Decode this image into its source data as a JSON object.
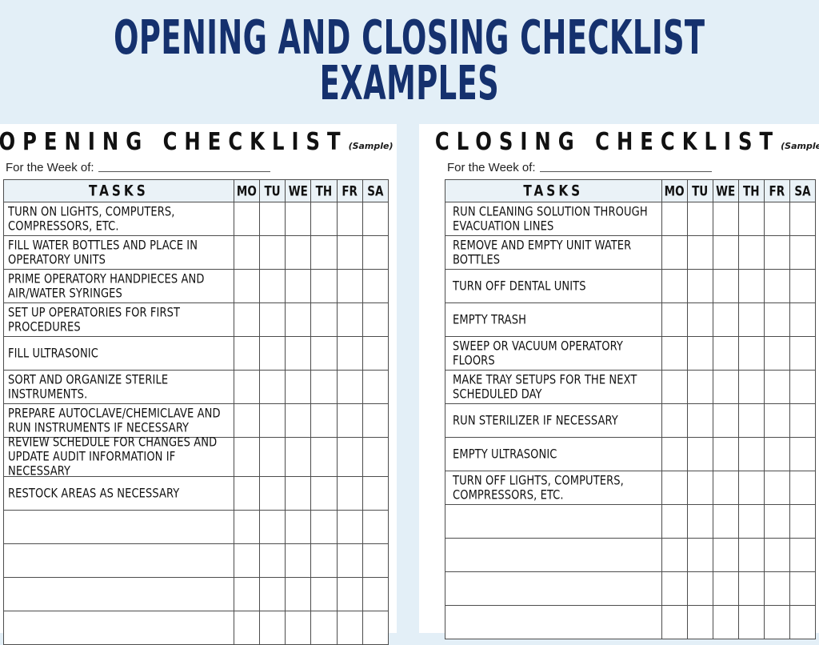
{
  "banner": {
    "line1": "OPENING AND CLOSING CHECKLIST",
    "line2": "EXAMPLES",
    "background_color": "#e3eff7",
    "text_color": "#15316e"
  },
  "colors": {
    "page_background": "#e3eff7",
    "panel_background": "#ffffff",
    "table_header_fill": "#eaf2f7",
    "table_border": "#4d4d4d",
    "title_navy": "#15316e",
    "text_black": "#111111"
  },
  "sheets": [
    {
      "id": "opening",
      "title": "OPENING CHECKLIST",
      "sample_tag": "(Sample)",
      "week_label": "For the Week of:",
      "week_value": "",
      "columns": {
        "tasks_header": "TASKS",
        "days": [
          "MO",
          "TU",
          "WE",
          "TH",
          "FR",
          "SA"
        ]
      },
      "tasks": [
        "TURN ON LIGHTS, COMPUTERS, COMPRESSORS, ETC.",
        "FILL WATER BOTTLES AND PLACE IN OPERATORY UNITS",
        "PRIME OPERATORY HANDPIECES AND AIR/WATER SYRINGES",
        "SET UP OPERATORIES FOR FIRST PROCEDURES",
        "FILL ULTRASONIC",
        "SORT AND ORGANIZE STERILE INSTRUMENTS.",
        "PREPARE AUTOCLAVE/CHEMICLAVE AND RUN INSTRUMENTS IF NECESSARY",
        "REVIEW SCHEDULE FOR CHANGES AND UPDATE AUDIT INFORMATION IF NECESSARY",
        "RESTOCK AREAS AS NECESSARY",
        "",
        "",
        "",
        ""
      ]
    },
    {
      "id": "closing",
      "title": "CLOSING CHECKLIST",
      "sample_tag": "(Sample)",
      "week_label": "For the Week of:",
      "week_value": "",
      "columns": {
        "tasks_header": "TASKS",
        "days": [
          "MO",
          "TU",
          "WE",
          "TH",
          "FR",
          "SA"
        ]
      },
      "tasks": [
        "RUN CLEANING SOLUTION THROUGH EVACUATION LINES",
        "REMOVE AND EMPTY UNIT WATER BOTTLES",
        "TURN OFF DENTAL UNITS",
        "EMPTY TRASH",
        "SWEEP OR VACUUM OPERATORY FLOORS",
        "MAKE TRAY SETUPS FOR THE NEXT SCHEDULED DAY",
        "RUN STERILIZER IF NECESSARY",
        "EMPTY ULTRASONIC",
        "TURN OFF LIGHTS, COMPUTERS, COMPRESSORS, ETC.",
        "",
        "",
        "",
        ""
      ]
    }
  ]
}
